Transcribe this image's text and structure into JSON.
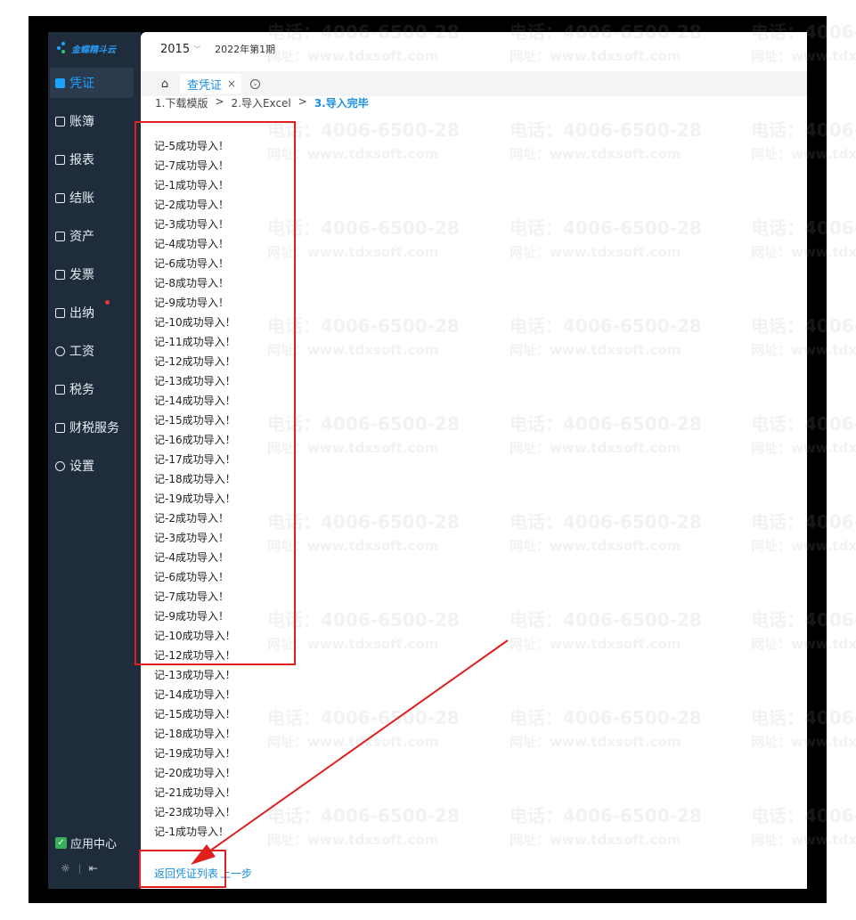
{
  "sidebar": {
    "logo_text": "金蝶精斗云",
    "items": [
      {
        "label": "凭证",
        "icon": "voucher-icon"
      },
      {
        "label": "账簿",
        "icon": "ledger-icon"
      },
      {
        "label": "报表",
        "icon": "report-icon"
      },
      {
        "label": "结账",
        "icon": "closing-icon"
      },
      {
        "label": "资产",
        "icon": "asset-icon"
      },
      {
        "label": "发票",
        "icon": "invoice-icon"
      },
      {
        "label": "出纳",
        "icon": "cashier-icon"
      },
      {
        "label": "工资",
        "icon": "salary-icon"
      },
      {
        "label": "税务",
        "icon": "tax-icon"
      },
      {
        "label": "财税服务",
        "icon": "service-icon"
      },
      {
        "label": "设置",
        "icon": "settings-icon"
      }
    ],
    "app_center": "应用中心"
  },
  "topbar": {
    "year": "2015",
    "period": "2022年第1期"
  },
  "tabs": {
    "active_tab": "查凭证"
  },
  "steps": {
    "step1": "1.下载模版",
    "sep": ">",
    "step2": "2.导入Excel",
    "step3": "3.导入完毕"
  },
  "import_log": [
    "记-5成功导入！",
    "记-7成功导入！",
    "记-1成功导入！",
    "记-2成功导入！",
    "记-3成功导入！",
    "记-4成功导入！",
    "记-6成功导入！",
    "记-8成功导入！",
    "记-9成功导入！",
    "记-10成功导入！",
    "记-11成功导入！",
    "记-12成功导入！",
    "记-13成功导入！",
    "记-14成功导入！",
    "记-15成功导入！",
    "记-16成功导入！",
    "记-17成功导入！",
    "记-18成功导入！",
    "记-19成功导入！",
    "记-2成功导入！",
    "记-3成功导入！",
    "记-4成功导入！",
    "记-6成功导入！",
    "记-7成功导入！",
    "记-9成功导入！",
    "记-10成功导入！",
    "记-12成功导入！",
    "记-13成功导入！",
    "记-14成功导入！",
    "记-15成功导入！",
    "记-18成功导入！",
    "记-19成功导入！",
    "记-20成功导入！",
    "记-21成功导入！",
    "记-23成功导入！",
    "记-1成功导入！"
  ],
  "bottom_links": {
    "back": "返回凭证列表",
    "prev": "上一步"
  },
  "watermark": {
    "phone": "电话：4006-6500-28",
    "web": "网址：www.tdxsoft.com"
  },
  "colors": {
    "sidebar_bg": "#1f2c3c",
    "accent": "#1a8fe3",
    "highlight": "#e0201f"
  }
}
